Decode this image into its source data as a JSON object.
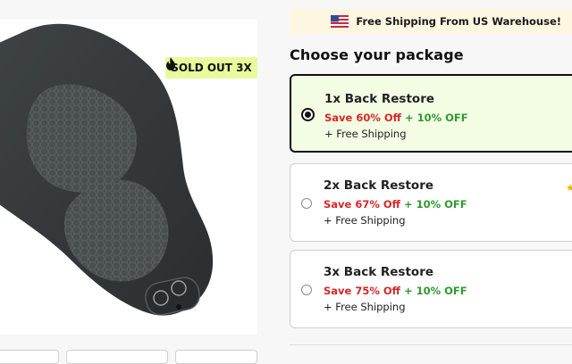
{
  "product": {
    "image_icon": "massager-pillow-image",
    "badge": "SOLD OUT 3X",
    "badge_icon": "fire-icon"
  },
  "banner": {
    "text": "Free Shipping From US Warehouse!",
    "flag_icon": "us-flag-icon"
  },
  "section_title": "Choose your package",
  "packages": [
    {
      "name": "1x Back Restore",
      "save": "Save 60% Off",
      "extra": "+ 10% OFF",
      "shipping": "+ Free Shipping",
      "selected": true
    },
    {
      "name": "2x Back Restore",
      "save": "Save 67% Off",
      "extra": "+ 10% OFF",
      "shipping": "+ Free Shipping",
      "selected": false
    },
    {
      "name": "3x Back Restore",
      "save": "Save 75% Off",
      "extra": "+ 10% OFF",
      "shipping": "+ Free Shipping",
      "selected": false
    }
  ],
  "colors": {
    "badge_bg": "#e6fb9b",
    "selected_bg": "#f3fde4",
    "save_red": "#d62828",
    "extra_green": "#2e9a2e",
    "banner_bg": "#fdf7e2"
  }
}
